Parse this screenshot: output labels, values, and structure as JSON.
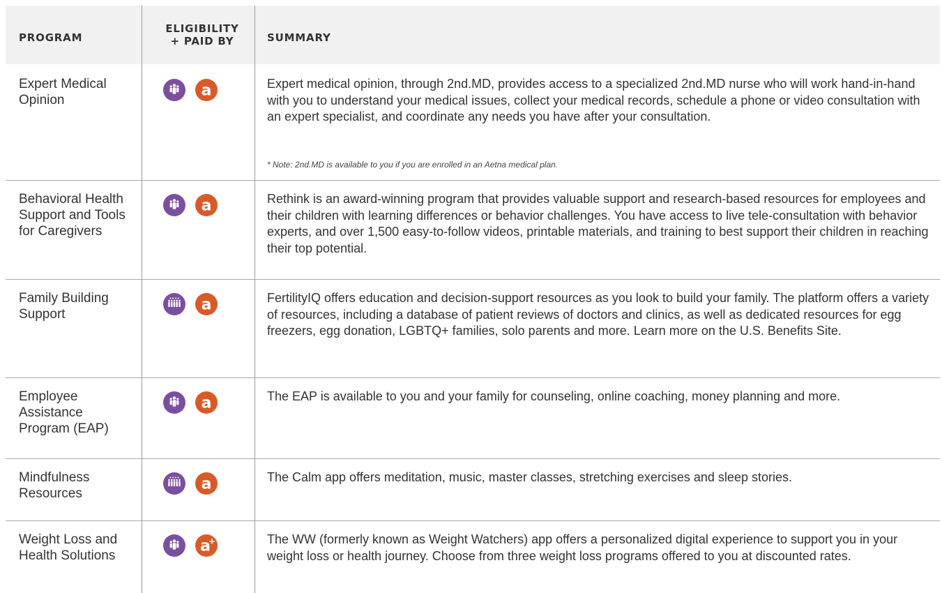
{
  "header": {
    "program": "PROGRAM",
    "eligibility_line1": "ELIGIBILITY",
    "eligibility_line2": "+ PAID BY",
    "summary": "SUMMARY"
  },
  "colors": {
    "eligibility_icon": "#7b4fa0",
    "paid_by_icon": "#d95a28",
    "header_bg": "#f1f1f1"
  },
  "rows": [
    {
      "program": "Expert Medical Opinion",
      "eligibility_icon": "employee-icon",
      "paid_by_icon": "company-paid-icon",
      "summary": "Expert medical opinion, through 2nd.MD, provides access to a specialized 2nd.MD nurse who will work hand-in-hand with you to understand your medical issues, collect your medical records, schedule a phone or video consultation with an expert specialist, and coordinate any needs you have after your consultation.",
      "note": "* Note: 2nd.MD is available to you if you are enrolled in an Aetna medical plan."
    },
    {
      "program": "Behavioral Health Support and Tools for Caregivers",
      "eligibility_icon": "employee-icon",
      "paid_by_icon": "company-paid-icon",
      "summary": "Rethink is an award-winning program that provides valuable support and research-based resources for employees and their children with learning differences or behavior challenges. You have access to live tele-consultation with behavior experts, and over 1,500 easy-to-follow videos, printable materials, and training to best support their children in reaching their top potential."
    },
    {
      "program": "Family Building Support",
      "eligibility_icon": "family-icon",
      "paid_by_icon": "company-paid-icon",
      "summary": "FertilityIQ offers education and decision-support resources as you look to build your family. The platform offers a variety of resources, including a database of patient reviews of doctors and clinics, as well as dedicated resources for egg freezers, egg donation, LGBTQ+ families, solo parents and more. Learn more on the U.S. Benefits Site."
    },
    {
      "program": "Employee Assistance Program (EAP)",
      "eligibility_icon": "employee-icon",
      "paid_by_icon": "company-paid-icon",
      "summary": "The EAP is available to you and your family for counseling, online coaching, money planning and more."
    },
    {
      "program": "Mindfulness Resources",
      "eligibility_icon": "family-icon",
      "paid_by_icon": "company-paid-icon",
      "summary": "The Calm app offers meditation, music, master classes, stretching exercises and sleep stories."
    },
    {
      "program": "Weight Loss and Health Solutions",
      "eligibility_icon": "employee-icon",
      "paid_by_icon": "company-paid-plus-icon",
      "summary": "The WW (formerly known as Weight Watchers) app offers a personalized digital experience to support you in your weight loss or health journey. Choose from three weight loss programs offered to you at discounted rates."
    }
  ]
}
